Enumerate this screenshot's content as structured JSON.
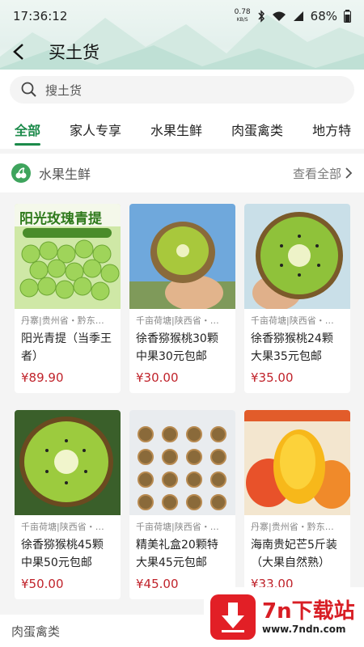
{
  "status": {
    "time": "17:36:12",
    "net_speed": "0.78",
    "net_unit": "KB/S",
    "battery": "68%"
  },
  "title": "买土货",
  "search": {
    "placeholder": "搜土货"
  },
  "tabs": [
    "全部",
    "家人专享",
    "水果生鲜",
    "肉蛋禽类",
    "地方特"
  ],
  "section": {
    "title": "水果生鲜",
    "see_all": "查看全部"
  },
  "products": [
    {
      "meta": "丹寨|贵州省・黔东…",
      "name": "阳光青提（当季王者）",
      "price": "¥89.90",
      "banner": "阳光玫瑰青提"
    },
    {
      "meta": "千亩荷塘|陕西省・…",
      "name": "徐香猕猴桃30颗中果30元包邮",
      "price": "¥30.00"
    },
    {
      "meta": "千亩荷塘|陕西省・…",
      "name": "徐香猕猴桃24颗大果35元包邮",
      "price": "¥35.00"
    },
    {
      "meta": "千亩荷塘|陕西省・…",
      "name": "徐香猕猴桃45颗中果50元包邮",
      "price": "¥50.00"
    },
    {
      "meta": "千亩荷塘|陕西省・…",
      "name": "精美礼盒20颗特大果45元包邮",
      "price": "¥45.00"
    },
    {
      "meta": "丹寨|贵州省・黔东…",
      "name": "海南贵妃芒5斤装（大果自然熟）",
      "price": "¥33.00"
    }
  ],
  "bottom_section": "肉蛋禽类",
  "watermark": {
    "title": "7n下载站",
    "url": "www.7ndn.com"
  },
  "colors": {
    "accent": "#1b8a4a",
    "price": "#c0232b"
  }
}
